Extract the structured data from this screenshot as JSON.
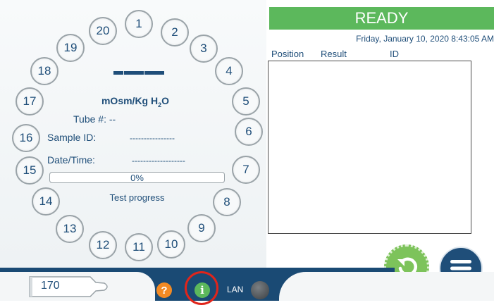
{
  "dial": {
    "tubes": [
      "1",
      "2",
      "3",
      "4",
      "5",
      "6",
      "7",
      "8",
      "9",
      "10",
      "11",
      "12",
      "13",
      "14",
      "15",
      "16",
      "17",
      "18",
      "19",
      "20"
    ],
    "units_main": "mOsm/Kg H",
    "units_sub": "2",
    "units_tail": "O",
    "tube_label": "Tube #:",
    "tube_value": "--",
    "sample_id_label": "Sample ID:",
    "sample_id_value": "----------------",
    "datetime_label": "Date/Time:",
    "datetime_value": "-------------------",
    "progress_percent": 0,
    "progress_text": "0%",
    "progress_caption": "Test progress"
  },
  "status": {
    "text": "READY",
    "color": "#5cb85c"
  },
  "datetime": "Friday, January 10, 2020 8:43:05 AM",
  "results_table": {
    "columns": [
      "Position",
      "Result",
      "ID"
    ],
    "rows": []
  },
  "buttons": {
    "refresh_icon": "refresh-icon",
    "menu_icon": "hamburger-menu-icon"
  },
  "bottom_bar": {
    "sample_tube_number": "170",
    "help_symbol": "?",
    "info_symbol": "i",
    "lan_label": "LAN"
  }
}
